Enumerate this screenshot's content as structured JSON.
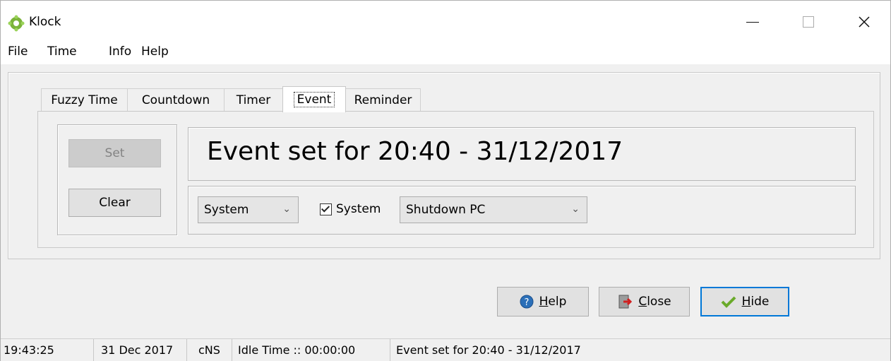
{
  "window": {
    "title": "Klock",
    "icon": "klock-app-icon",
    "controls": [
      "minimize-icon",
      "maximize-icon",
      "close-icon"
    ]
  },
  "menu": {
    "items": [
      "File",
      "Time",
      "Info",
      "Help"
    ]
  },
  "tabs": {
    "items": [
      "Fuzzy Time",
      "Countdown",
      "Timer",
      "Event",
      "Reminder"
    ],
    "active": "Event"
  },
  "event": {
    "set_label": "Set",
    "clear_label": "Clear",
    "display": "Event set for 20:40 - 31/12/2017",
    "type_combo": "System",
    "system_checkbox_label": "System",
    "system_checked": true,
    "action_combo": "Shutdown PC"
  },
  "actions": {
    "help_label": "Help",
    "close_label": "Close",
    "hide_label": "Hide",
    "help_icon": "help-circle-icon",
    "close_icon": "exit-door-icon",
    "hide_icon": "checkmark-icon"
  },
  "status": {
    "time": "19:43:25",
    "date": "31 Dec 2017",
    "mode": "cNS",
    "idle": "Idle Time :: 00:00:00",
    "event": "Event set for 20:40 - 31/12/2017"
  },
  "colors": {
    "focus_border": "#0078d7",
    "icon_green": "#7bb33a"
  }
}
